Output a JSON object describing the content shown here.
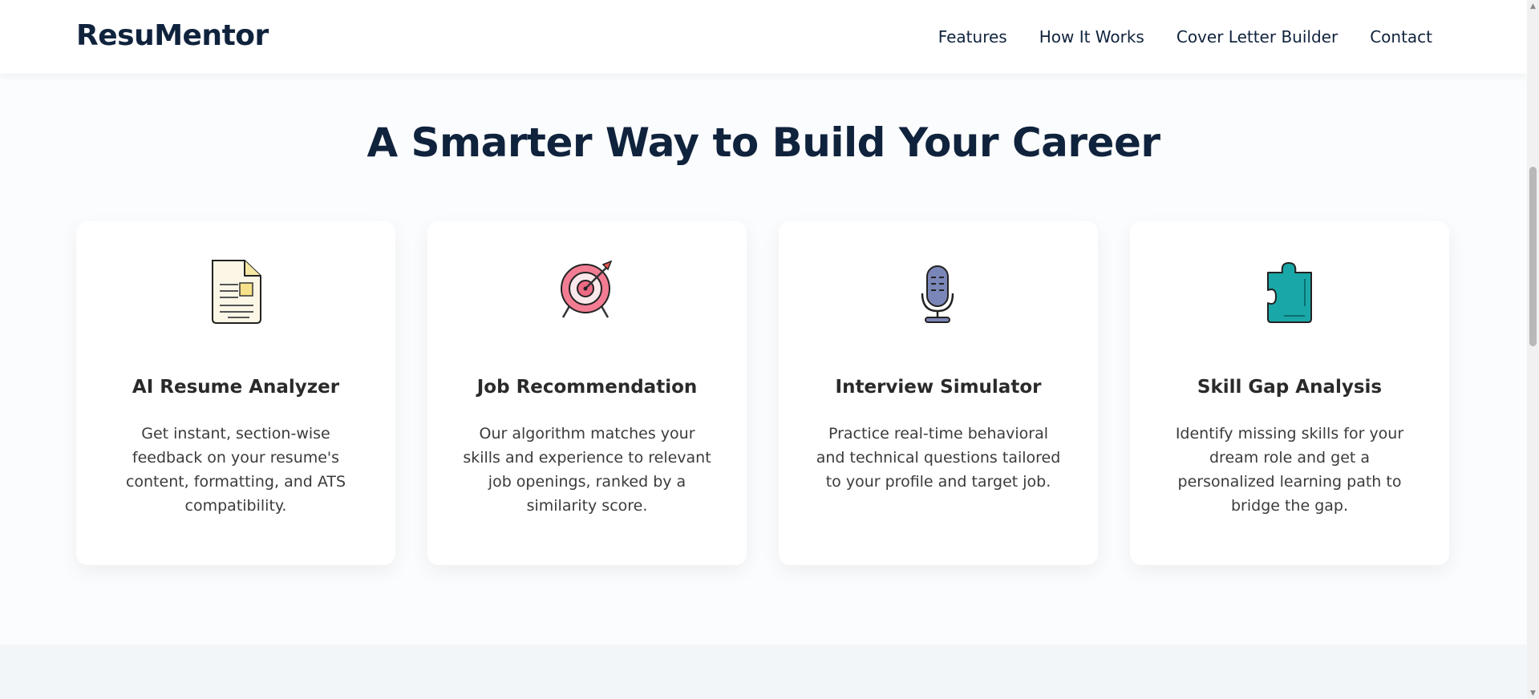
{
  "header": {
    "logo": "ResuMentor",
    "nav": [
      {
        "label": "Features"
      },
      {
        "label": "How It Works"
      },
      {
        "label": "Cover Letter Builder"
      },
      {
        "label": "Contact"
      }
    ]
  },
  "features": {
    "title": "A Smarter Way to Build Your Career",
    "cards": [
      {
        "icon": "document-icon",
        "title": "AI Resume Analyzer",
        "description": "Get instant, section-wise feedback on your resume's content, formatting, and ATS compatibility."
      },
      {
        "icon": "target-icon",
        "title": "Job Recommendation",
        "description": "Our algorithm matches your skills and experience to relevant job openings, ranked by a similarity score."
      },
      {
        "icon": "microphone-icon",
        "title": "Interview Simulator",
        "description": "Practice real-time behavioral and technical questions tailored to your profile and target job."
      },
      {
        "icon": "puzzle-icon",
        "title": "Skill Gap Analysis",
        "description": "Identify missing skills for your dream role and get a personalized learning path to bridge the gap."
      }
    ]
  },
  "colors": {
    "brand_navy": "#10233d",
    "card_bg": "#ffffff",
    "page_bg": "#fbfcfd",
    "band_bg": "#f3f6f9"
  }
}
